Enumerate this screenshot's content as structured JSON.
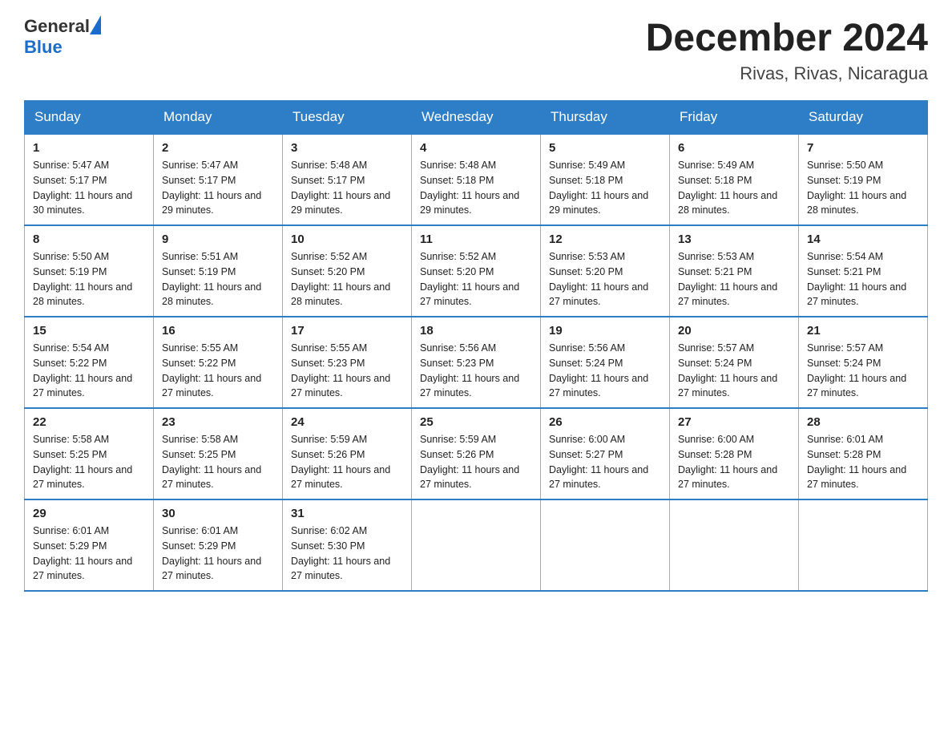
{
  "header": {
    "logo_general": "General",
    "logo_blue": "Blue",
    "title": "December 2024",
    "location": "Rivas, Rivas, Nicaragua"
  },
  "days_of_week": [
    "Sunday",
    "Monday",
    "Tuesday",
    "Wednesday",
    "Thursday",
    "Friday",
    "Saturday"
  ],
  "weeks": [
    [
      {
        "day": "1",
        "sunrise": "5:47 AM",
        "sunset": "5:17 PM",
        "daylight": "11 hours and 30 minutes."
      },
      {
        "day": "2",
        "sunrise": "5:47 AM",
        "sunset": "5:17 PM",
        "daylight": "11 hours and 29 minutes."
      },
      {
        "day": "3",
        "sunrise": "5:48 AM",
        "sunset": "5:17 PM",
        "daylight": "11 hours and 29 minutes."
      },
      {
        "day": "4",
        "sunrise": "5:48 AM",
        "sunset": "5:18 PM",
        "daylight": "11 hours and 29 minutes."
      },
      {
        "day": "5",
        "sunrise": "5:49 AM",
        "sunset": "5:18 PM",
        "daylight": "11 hours and 29 minutes."
      },
      {
        "day": "6",
        "sunrise": "5:49 AM",
        "sunset": "5:18 PM",
        "daylight": "11 hours and 28 minutes."
      },
      {
        "day": "7",
        "sunrise": "5:50 AM",
        "sunset": "5:19 PM",
        "daylight": "11 hours and 28 minutes."
      }
    ],
    [
      {
        "day": "8",
        "sunrise": "5:50 AM",
        "sunset": "5:19 PM",
        "daylight": "11 hours and 28 minutes."
      },
      {
        "day": "9",
        "sunrise": "5:51 AM",
        "sunset": "5:19 PM",
        "daylight": "11 hours and 28 minutes."
      },
      {
        "day": "10",
        "sunrise": "5:52 AM",
        "sunset": "5:20 PM",
        "daylight": "11 hours and 28 minutes."
      },
      {
        "day": "11",
        "sunrise": "5:52 AM",
        "sunset": "5:20 PM",
        "daylight": "11 hours and 27 minutes."
      },
      {
        "day": "12",
        "sunrise": "5:53 AM",
        "sunset": "5:20 PM",
        "daylight": "11 hours and 27 minutes."
      },
      {
        "day": "13",
        "sunrise": "5:53 AM",
        "sunset": "5:21 PM",
        "daylight": "11 hours and 27 minutes."
      },
      {
        "day": "14",
        "sunrise": "5:54 AM",
        "sunset": "5:21 PM",
        "daylight": "11 hours and 27 minutes."
      }
    ],
    [
      {
        "day": "15",
        "sunrise": "5:54 AM",
        "sunset": "5:22 PM",
        "daylight": "11 hours and 27 minutes."
      },
      {
        "day": "16",
        "sunrise": "5:55 AM",
        "sunset": "5:22 PM",
        "daylight": "11 hours and 27 minutes."
      },
      {
        "day": "17",
        "sunrise": "5:55 AM",
        "sunset": "5:23 PM",
        "daylight": "11 hours and 27 minutes."
      },
      {
        "day": "18",
        "sunrise": "5:56 AM",
        "sunset": "5:23 PM",
        "daylight": "11 hours and 27 minutes."
      },
      {
        "day": "19",
        "sunrise": "5:56 AM",
        "sunset": "5:24 PM",
        "daylight": "11 hours and 27 minutes."
      },
      {
        "day": "20",
        "sunrise": "5:57 AM",
        "sunset": "5:24 PM",
        "daylight": "11 hours and 27 minutes."
      },
      {
        "day": "21",
        "sunrise": "5:57 AM",
        "sunset": "5:24 PM",
        "daylight": "11 hours and 27 minutes."
      }
    ],
    [
      {
        "day": "22",
        "sunrise": "5:58 AM",
        "sunset": "5:25 PM",
        "daylight": "11 hours and 27 minutes."
      },
      {
        "day": "23",
        "sunrise": "5:58 AM",
        "sunset": "5:25 PM",
        "daylight": "11 hours and 27 minutes."
      },
      {
        "day": "24",
        "sunrise": "5:59 AM",
        "sunset": "5:26 PM",
        "daylight": "11 hours and 27 minutes."
      },
      {
        "day": "25",
        "sunrise": "5:59 AM",
        "sunset": "5:26 PM",
        "daylight": "11 hours and 27 minutes."
      },
      {
        "day": "26",
        "sunrise": "6:00 AM",
        "sunset": "5:27 PM",
        "daylight": "11 hours and 27 minutes."
      },
      {
        "day": "27",
        "sunrise": "6:00 AM",
        "sunset": "5:28 PM",
        "daylight": "11 hours and 27 minutes."
      },
      {
        "day": "28",
        "sunrise": "6:01 AM",
        "sunset": "5:28 PM",
        "daylight": "11 hours and 27 minutes."
      }
    ],
    [
      {
        "day": "29",
        "sunrise": "6:01 AM",
        "sunset": "5:29 PM",
        "daylight": "11 hours and 27 minutes."
      },
      {
        "day": "30",
        "sunrise": "6:01 AM",
        "sunset": "5:29 PM",
        "daylight": "11 hours and 27 minutes."
      },
      {
        "day": "31",
        "sunrise": "6:02 AM",
        "sunset": "5:30 PM",
        "daylight": "11 hours and 27 minutes."
      },
      null,
      null,
      null,
      null
    ]
  ]
}
